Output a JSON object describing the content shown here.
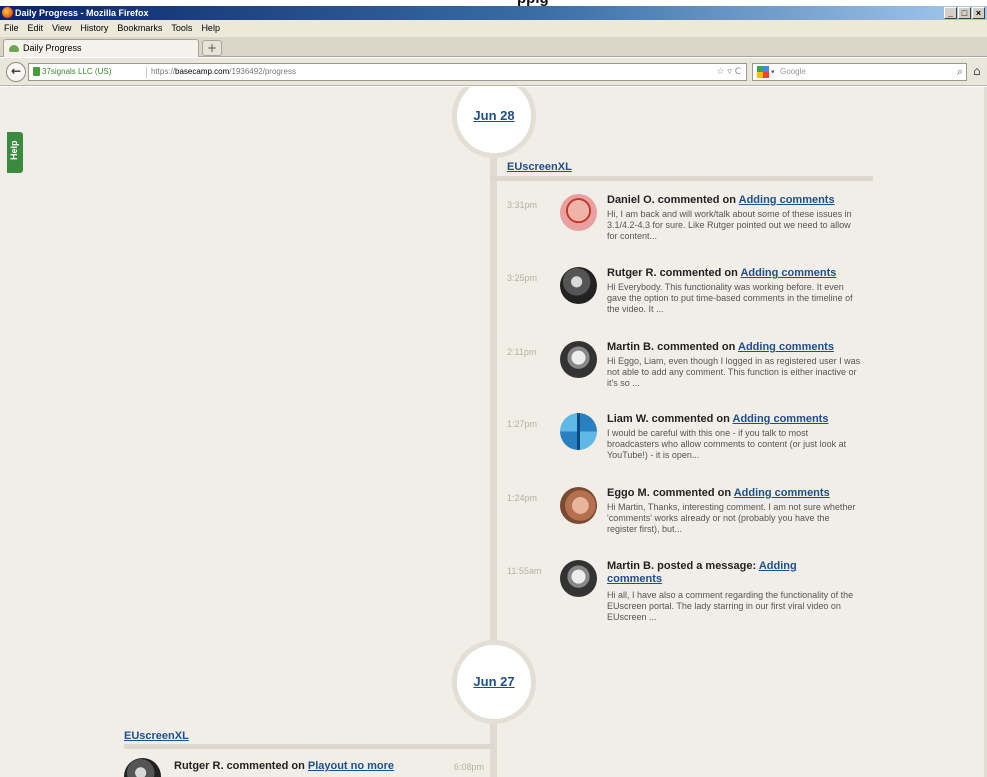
{
  "page_heading": "ppig",
  "window": {
    "title": "Daily Progress - Mozilla Firefox",
    "buttons": [
      "_",
      "□",
      "×"
    ]
  },
  "menu": [
    "File",
    "Edit",
    "View",
    "History",
    "Bookmarks",
    "Tools",
    "Help"
  ],
  "tab": {
    "label": "Daily Progress",
    "new_tab": "+"
  },
  "nav": {
    "identity": "37signals LLC (US)",
    "url_prefix": "https://",
    "url_domain": "basecamp.com",
    "url_path": "/1936492/progress",
    "url_icons": "☆ ▿ C",
    "search_placeholder": "Google"
  },
  "help_label": "Help",
  "days": [
    {
      "date": "Jun 28",
      "project": "EUscreenXL",
      "entries": [
        {
          "time": "3:31pm",
          "author": "Daniel O.",
          "verb": "commented on",
          "target": "Adding comments",
          "excerpt": "Hi, I am back and will work/talk about some of these issues in 3.1/4.2-4.3 for sure. Like Rutger pointed out we need to allow for content..."
        },
        {
          "time": "3:25pm",
          "author": "Rutger R.",
          "verb": "commented on",
          "target": "Adding comments",
          "excerpt": "Hi Everybody. This functionality was working before. It even gave the option to put time-based comments in the timeline of the video. It ..."
        },
        {
          "time": "2:11pm",
          "author": "Martin B.",
          "verb": "commented on",
          "target": "Adding comments",
          "excerpt": "Hi Eggo, Liam, even though I logged in as registered user I was not able to add any comment. This function is either inactive or it's so ..."
        },
        {
          "time": "1:27pm",
          "author": "Liam W.",
          "verb": "commented on",
          "target": "Adding comments",
          "excerpt": "I would be careful with this one - if you talk to most broadcasters who allow comments to content (or just look at YouTube!) - it is open..."
        },
        {
          "time": "1:24pm",
          "author": "Eggo M.",
          "verb": "commented on",
          "target": "Adding comments",
          "excerpt": "Hi Martin, Thanks, interesting comment. I am not sure whether 'comments' works already or not (probably you have the register first), but..."
        },
        {
          "time": "11:55am",
          "author": "Martin B.",
          "verb": "posted a message:",
          "target": "Adding comments",
          "excerpt": "Hi all, I have also a comment regarding the functionality of the EUscreen portal. The lady starring in our first viral video on EUscreen ..."
        }
      ]
    },
    {
      "date": "Jun 27",
      "project": "EUscreenXL",
      "entries": [
        {
          "time": "6:08pm",
          "author": "Rutger R.",
          "verb": "commented on",
          "target": "Playout no more"
        }
      ]
    }
  ]
}
